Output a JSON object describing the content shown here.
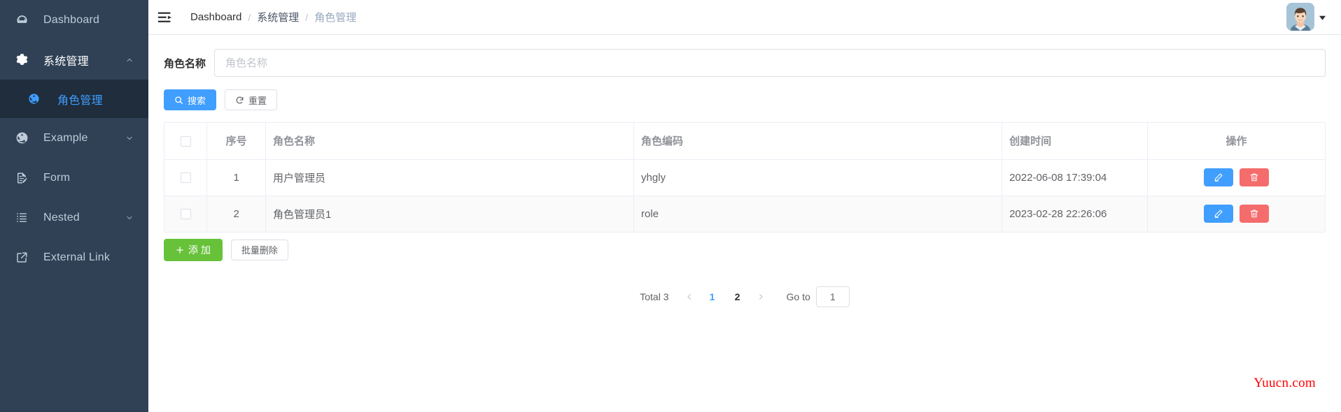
{
  "sidebar": {
    "items": [
      {
        "label": "Dashboard",
        "icon": "dashboard-icon",
        "arrow": "",
        "state": "normal"
      },
      {
        "label": "系统管理",
        "icon": "gear-icon",
        "arrow": "⌃",
        "state": "open"
      },
      {
        "label": "角色管理",
        "icon": "component-icon",
        "arrow": "",
        "state": "active-sub"
      },
      {
        "label": "Example",
        "icon": "component-icon",
        "arrow": "⌄",
        "state": "normal"
      },
      {
        "label": "Form",
        "icon": "form-icon",
        "arrow": "",
        "state": "normal"
      },
      {
        "label": "Nested",
        "icon": "nested-list-icon",
        "arrow": "⌄",
        "state": "normal"
      },
      {
        "label": "External Link",
        "icon": "external-link-icon",
        "arrow": "",
        "state": "normal"
      }
    ],
    "bg_color": "#304156",
    "active_color": "#409EFF",
    "active_bg": "#1f2d3d"
  },
  "navbar": {
    "hamburger_icon": "hamburger-collapse-icon",
    "breadcrumb": [
      {
        "label": "Dashboard",
        "current": false
      },
      {
        "label": "系统管理",
        "current": false
      },
      {
        "label": "角色管理",
        "current": true
      }
    ],
    "separator": "/",
    "avatar_icon": "user-avatar",
    "caret_icon": "caret-down-icon"
  },
  "filter": {
    "label": "角色名称",
    "placeholder": "角色名称",
    "value": ""
  },
  "toolbar": {
    "search_label": "搜索",
    "search_icon": "search-icon",
    "reset_label": "重置",
    "reset_icon": "refresh-icon",
    "add_label": "添 加",
    "add_icon": "plus-icon",
    "batch_delete_label": "批量删除"
  },
  "table": {
    "columns": [
      "",
      "序号",
      "角色名称",
      "角色编码",
      "创建时间",
      "操作"
    ],
    "rows": [
      {
        "idx": "1",
        "name": "用户管理员",
        "code": "yhgly",
        "time": "2022-06-08 17:39:04"
      },
      {
        "idx": "2",
        "name": "角色管理员1",
        "code": "role",
        "time": "2023-02-28 22:26:06"
      }
    ],
    "edit_icon": "pencil-edit-icon",
    "delete_icon": "trash-delete-icon"
  },
  "pagination": {
    "total_label": "Total 3",
    "prev_icon": "chevron-left-icon",
    "next_icon": "chevron-right-icon",
    "pages": [
      {
        "label": "1",
        "active": true
      },
      {
        "label": "2",
        "active": false
      }
    ],
    "goto_label": "Go to",
    "goto_value": "1"
  },
  "watermark": {
    "text": "Yuucn.com",
    "color": "#ff0000"
  }
}
